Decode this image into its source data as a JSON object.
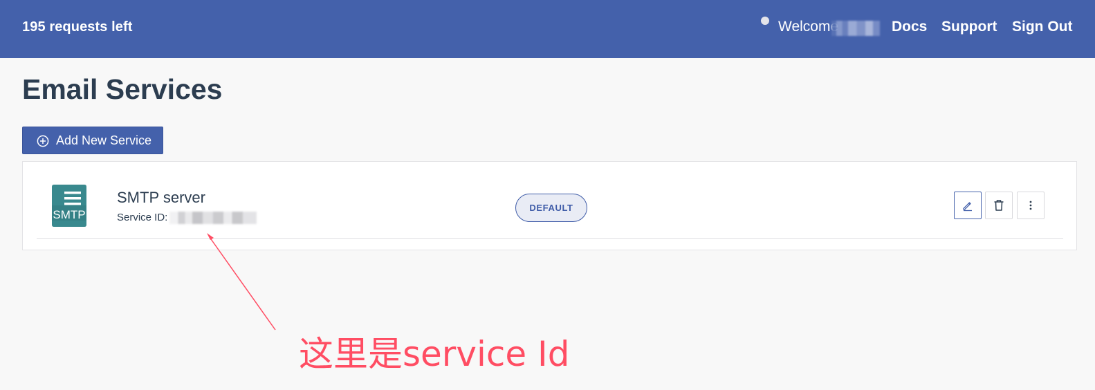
{
  "header": {
    "requests_left": "195 requests left",
    "welcome": "Welcome",
    "nav": {
      "docs": "Docs",
      "support": "Support",
      "sign_out": "Sign Out"
    },
    "background_color": "#4461ab"
  },
  "page": {
    "title": "Email Services",
    "add_button_label": "Add New Service"
  },
  "services": [
    {
      "icon": "smtp-icon",
      "icon_text": "SMTP",
      "name": "SMTP server",
      "id_label": "Service ID:",
      "badge": "DEFAULT",
      "actions": [
        "edit-icon",
        "trash-icon",
        "more-vertical-icon"
      ]
    }
  ],
  "annotation": {
    "text": "这里是service Id",
    "color": "#ff4d63"
  },
  "colors": {
    "primary": "#4461ab",
    "smtp_icon": "#39898e",
    "text": "#2c3d50"
  }
}
